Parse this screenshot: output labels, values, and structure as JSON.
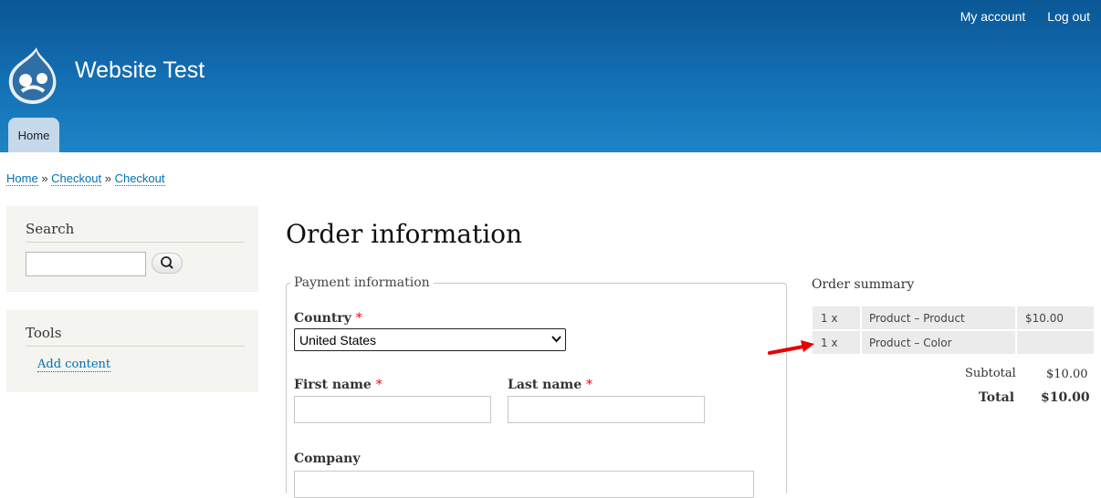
{
  "header": {
    "site_name": "Website Test",
    "links": [
      "My account",
      "Log out"
    ],
    "tabs": [
      "Home"
    ],
    "colors": {
      "top": "#0a5796",
      "bottom": "#1d84c6",
      "tab": "#c5d9ea"
    }
  },
  "breadcrumb": [
    "Home",
    "Checkout",
    "Checkout"
  ],
  "breadcrumb_separator": "»",
  "sidebar": {
    "search": {
      "title": "Search",
      "button_icon": "search-icon"
    },
    "tools": {
      "title": "Tools",
      "items": [
        "Add content"
      ]
    }
  },
  "main": {
    "title": "Order information",
    "payment": {
      "legend": "Payment information",
      "country_label": "Country",
      "country_value": "United States",
      "first_name_label": "First name",
      "last_name_label": "Last name",
      "company_label": "Company",
      "required_mark": "*"
    }
  },
  "order_summary": {
    "title": "Order summary",
    "rows": [
      {
        "qty": "1 x",
        "item": "Product – Product",
        "price": "$10.00"
      },
      {
        "qty": "1 x",
        "item": "Product – Color",
        "price": ""
      }
    ],
    "subtotal_label": "Subtotal",
    "subtotal_value": "$10.00",
    "total_label": "Total",
    "total_value": "$10.00"
  },
  "annotation": {
    "arrow_color": "#e60000"
  }
}
